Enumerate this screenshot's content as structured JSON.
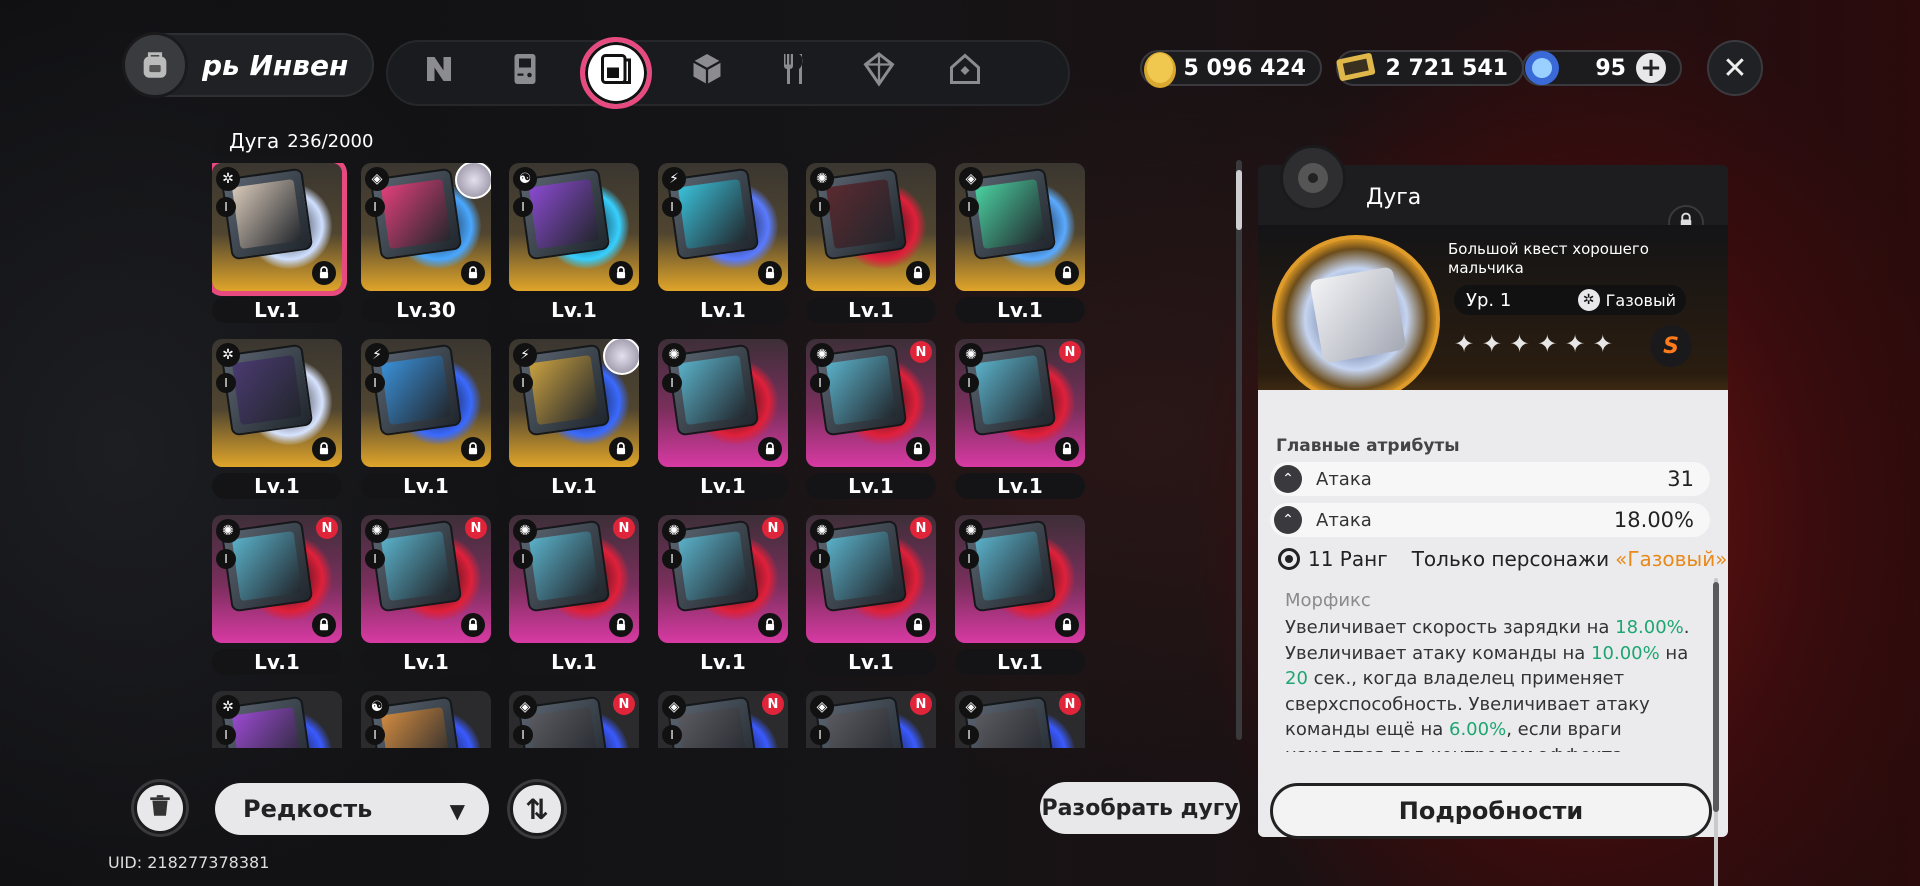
{
  "header": {
    "title": "рь  Инвен",
    "bag_icon": "backpack-icon"
  },
  "tabs": [
    {
      "icon": "n-logo-icon",
      "active": false
    },
    {
      "icon": "gameboy-icon",
      "active": false
    },
    {
      "icon": "disc-drive-icon",
      "active": true
    },
    {
      "icon": "cube-icon",
      "active": false
    },
    {
      "icon": "fork-knife-icon",
      "active": false
    },
    {
      "icon": "crystal-icon",
      "active": false
    },
    {
      "icon": "house-icon",
      "active": false
    }
  ],
  "currency": {
    "gold": "5 096 424",
    "tickets": "2 721 541",
    "crystals": "95"
  },
  "inventory": {
    "category": "Дуга",
    "count": "236/2000"
  },
  "cards": [
    {
      "level": "Lv.1",
      "style": "gold",
      "disc": "#cfe0ff",
      "inner": "#d7c8b8",
      "attr": "✲",
      "selected": true
    },
    {
      "level": "Lv.30",
      "style": "gold",
      "disc": "#4aa8ff",
      "inner": "#e0407a",
      "attr": "◈",
      "avatar": true
    },
    {
      "level": "Lv.1",
      "style": "gold",
      "disc": "#37d0ff",
      "inner": "#8a4ad0",
      "attr": "☯"
    },
    {
      "level": "Lv.1",
      "style": "gold",
      "disc": "#5a7bff",
      "inner": "#3ac0d8",
      "attr": "⚡"
    },
    {
      "level": "Lv.1",
      "style": "gold",
      "disc": "#e0203a",
      "inner": "#5a2a30",
      "attr": "✺"
    },
    {
      "level": "Lv.1",
      "style": "gold",
      "disc": "#5aaaff",
      "inner": "#4ad0a0",
      "attr": "◈"
    },
    {
      "level": "Lv.1",
      "style": "gold",
      "disc": "#d8e4ff",
      "inner": "#4a3a70",
      "attr": "✲"
    },
    {
      "level": "Lv.1",
      "style": "gold",
      "disc": "#3a6aff",
      "inner": "#3a90d8",
      "attr": "⚡"
    },
    {
      "level": "Lv.1",
      "style": "gold",
      "disc": "#3a6aff",
      "inner": "#c8a040",
      "attr": "⚡",
      "avatar": true
    },
    {
      "level": "Lv.1",
      "style": "pink",
      "disc": "#e0203a",
      "inner": "#5ab0c8",
      "attr": "✺"
    },
    {
      "level": "Lv.1",
      "style": "pink",
      "disc": "#e0203a",
      "inner": "#5ab0c8",
      "attr": "✺",
      "new": true
    },
    {
      "level": "Lv.1",
      "style": "pink",
      "disc": "#e0203a",
      "inner": "#5ab0c8",
      "attr": "✺",
      "new": true
    },
    {
      "level": "Lv.1",
      "style": "pink",
      "disc": "#e0203a",
      "inner": "#5ab0c8",
      "attr": "✺",
      "new": true
    },
    {
      "level": "Lv.1",
      "style": "pink",
      "disc": "#e0203a",
      "inner": "#5ab0c8",
      "attr": "✺",
      "new": true
    },
    {
      "level": "Lv.1",
      "style": "pink",
      "disc": "#e0203a",
      "inner": "#5ab0c8",
      "attr": "✺",
      "new": true
    },
    {
      "level": "Lv.1",
      "style": "pink",
      "disc": "#e0203a",
      "inner": "#5ab0c8",
      "attr": "✺",
      "new": true
    },
    {
      "level": "Lv.1",
      "style": "pink",
      "disc": "#e0203a",
      "inner": "#5ab0c8",
      "attr": "✺",
      "new": true
    },
    {
      "level": "Lv.1",
      "style": "pink",
      "disc": "#e0203a",
      "inner": "#5ab0c8",
      "attr": "✺"
    },
    {
      "level": "",
      "style": "dark",
      "disc": "#3a5aff",
      "inner": "#9a4ad0",
      "attr": "✲"
    },
    {
      "level": "",
      "style": "dark",
      "disc": "#3a5aff",
      "inner": "#d08a40",
      "attr": "☯"
    },
    {
      "level": "",
      "style": "dark",
      "disc": "#3a5aff",
      "inner": "#5a5a60",
      "attr": "◈",
      "new": true
    },
    {
      "level": "",
      "style": "dark",
      "disc": "#3a5aff",
      "inner": "#5a5a60",
      "attr": "◈",
      "new": true
    },
    {
      "level": "",
      "style": "dark",
      "disc": "#3a5aff",
      "inner": "#5a5a60",
      "attr": "◈",
      "new": true
    },
    {
      "level": "",
      "style": "dark",
      "disc": "#3a5aff",
      "inner": "#5a5a60",
      "attr": "◈",
      "new": true
    }
  ],
  "badges": {
    "new": "N",
    "level_one": "I"
  },
  "bottom": {
    "sort_label": "Редкость",
    "dismantle_label": "Разобрать дугу",
    "uid": "UID: 218277378381"
  },
  "detail": {
    "title": "Дуга",
    "set_name": "Большой квест хорошего мальчика",
    "level": "Ур. 1",
    "element": "Газовый",
    "stars": "✦ ✦ ✦ ✦ ✦ ✦",
    "rank_letter": "S",
    "main_attrs_label": "Главные атрибуты",
    "attrs": [
      {
        "name": "Атака",
        "value": "31"
      },
      {
        "name": "Атака",
        "value": "18.00%"
      }
    ],
    "rank": "11 Ранг",
    "restriction": "Только персонажи",
    "restriction_element": "«Газовый»",
    "morph_label": "Морфикс",
    "desc": [
      {
        "t": "Увеличивает скорость зарядки на "
      },
      {
        "t": "18.00%",
        "g": true
      },
      {
        "t": ". Увеличивает атаку команды на "
      },
      {
        "t": "10.00%",
        "g": true
      },
      {
        "t": " на "
      },
      {
        "t": "20",
        "g": true
      },
      {
        "t": " сек., когда владелец применяет сверхспособность. Увеличивает атаку команды ещё на "
      },
      {
        "t": "6.00%",
        "g": true
      },
      {
        "t": ", если враги находятся под контролем эффекта"
      }
    ],
    "details_button": "Подробности"
  },
  "colors": {
    "accent": "#e74a7f",
    "gold": "#e0a52a",
    "pink": "#d83aa3",
    "green": "#1ea672",
    "orange": "#e88a1a"
  }
}
